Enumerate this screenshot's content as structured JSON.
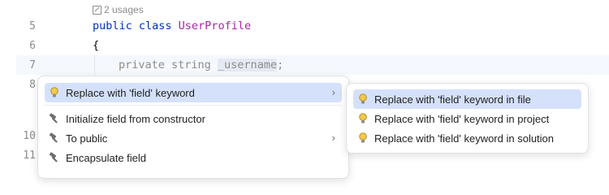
{
  "editor": {
    "usages_label": "2 usages",
    "lines": [
      {
        "number": "5",
        "keyword": "public class ",
        "class_name": "UserProfile"
      },
      {
        "number": "6",
        "text": "{"
      },
      {
        "number": "7",
        "modifier": "private string ",
        "field": "_username",
        "suffix": ";"
      },
      {
        "number": "8"
      },
      {
        "number": "10"
      },
      {
        "number": "11"
      }
    ]
  },
  "context_menu": {
    "items": [
      {
        "label": "Replace with 'field' keyword",
        "icon": "bulb-icon",
        "has_submenu": true,
        "selected": true
      },
      {
        "label": "Initialize field from constructor",
        "icon": "hammer-icon",
        "has_submenu": false
      },
      {
        "label": "To public",
        "icon": "hammer-icon",
        "has_submenu": true
      },
      {
        "label": "Encapsulate field",
        "icon": "hammer-icon",
        "has_submenu": false
      }
    ]
  },
  "submenu": {
    "items": [
      {
        "label": "Replace with 'field' keyword in file",
        "icon": "bulb-icon",
        "selected": true
      },
      {
        "label": "Replace with 'field' keyword in project",
        "icon": "bulb-icon"
      },
      {
        "label": "Replace with 'field' keyword in solution",
        "icon": "bulb-icon"
      }
    ]
  },
  "colors": {
    "keyword": "#0033b3",
    "class_name": "#a626a4",
    "selection": "#d5e1fa",
    "bulb": "#f2c94c"
  }
}
